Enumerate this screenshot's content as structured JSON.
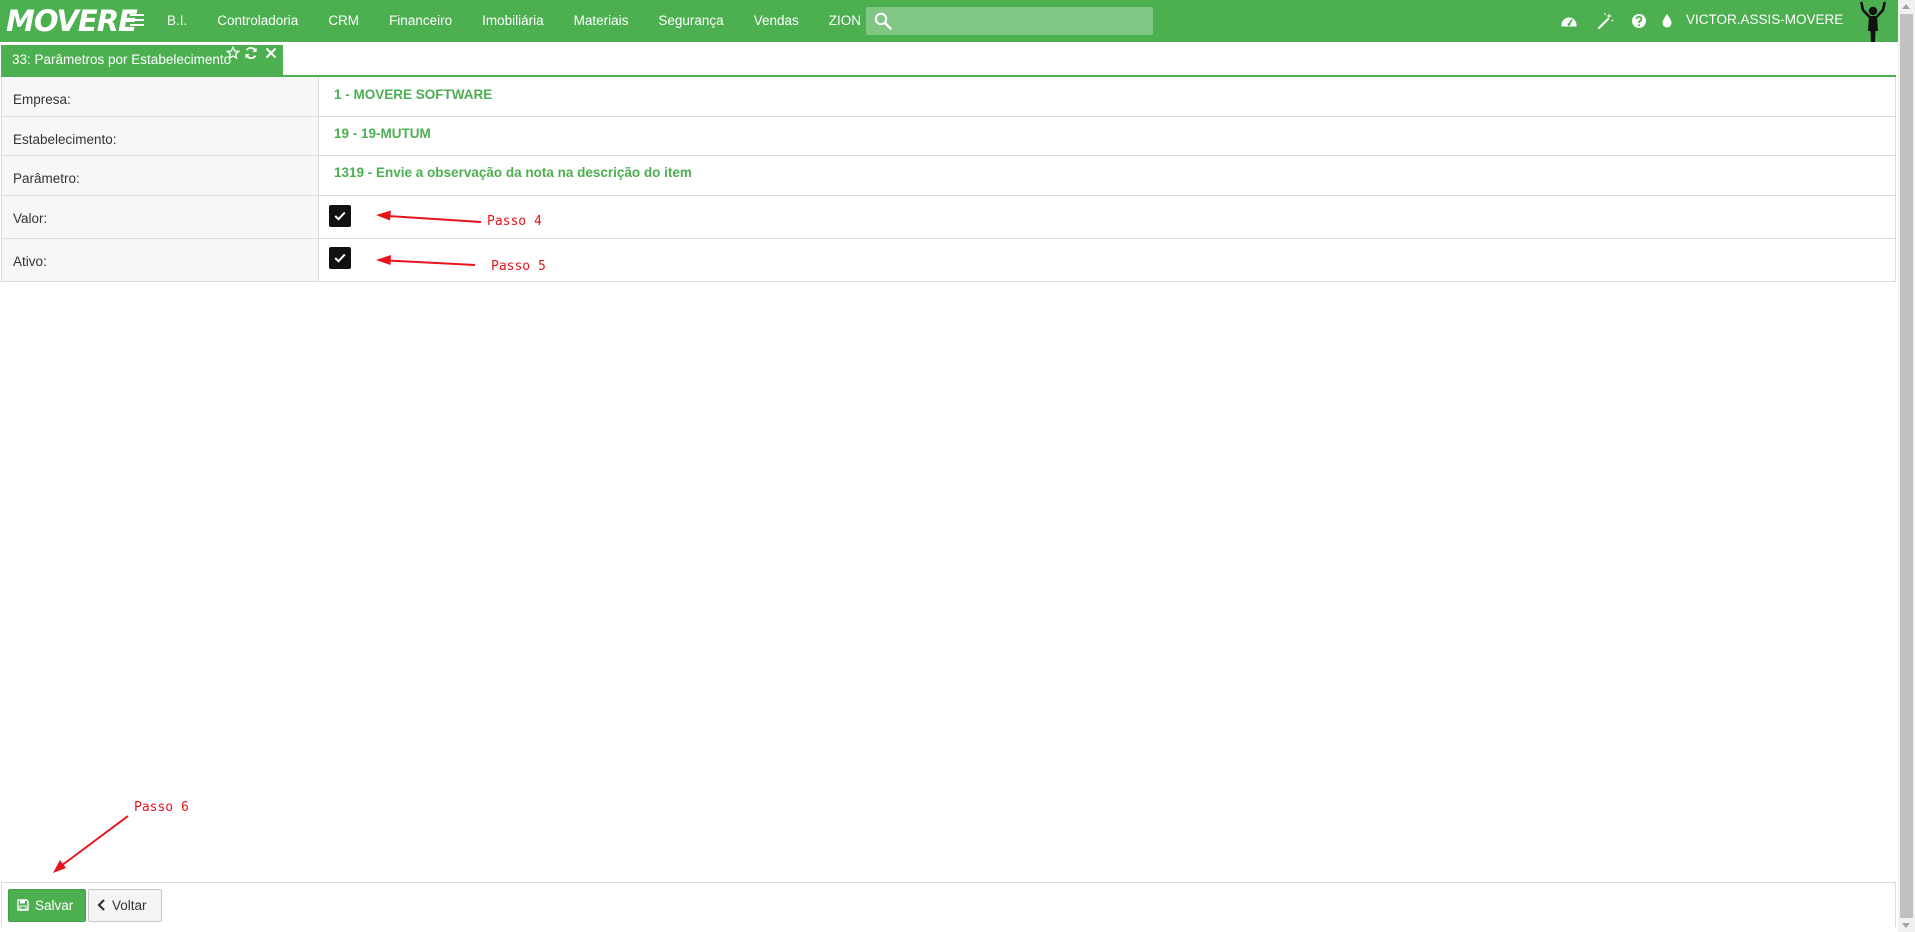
{
  "app": {
    "logo_text": "MOVERE",
    "menu": [
      "B.I.",
      "Controladoria",
      "CRM",
      "Financeiro",
      "Imobiliária",
      "Materiais",
      "Segurança",
      "Vendas",
      "ZION"
    ],
    "search_placeholder": "",
    "user": "VICTOR.ASSIS-MOVERE",
    "icons": [
      "dashboard-icon",
      "magic-wand-icon",
      "help-icon",
      "theme-drop-icon"
    ],
    "colors": {
      "brand": "#4caf50",
      "search_bg": "#81c784",
      "annotation": "#e8141c"
    }
  },
  "tab": {
    "title": "33: Parâmetros por Estabelecimento",
    "icons": [
      "star-icon",
      "refresh-icon",
      "close-icon"
    ]
  },
  "form": {
    "empresa": {
      "label": "Empresa:",
      "value": "1 - MOVERE SOFTWARE"
    },
    "estabelecimento": {
      "label": "Estabelecimento:",
      "value": "19 - 19-MUTUM"
    },
    "parametro": {
      "label": "Parâmetro:",
      "value": "1319 - Envie a observação da nota na descrição do item"
    },
    "valor": {
      "label": "Valor:",
      "checked": true
    },
    "ativo": {
      "label": "Ativo:",
      "checked": true
    }
  },
  "annotations": {
    "passo4": "Passo 4",
    "passo5": "Passo 5",
    "passo6": "Passo 6"
  },
  "footer": {
    "save_label": "Salvar",
    "back_label": "Voltar"
  }
}
